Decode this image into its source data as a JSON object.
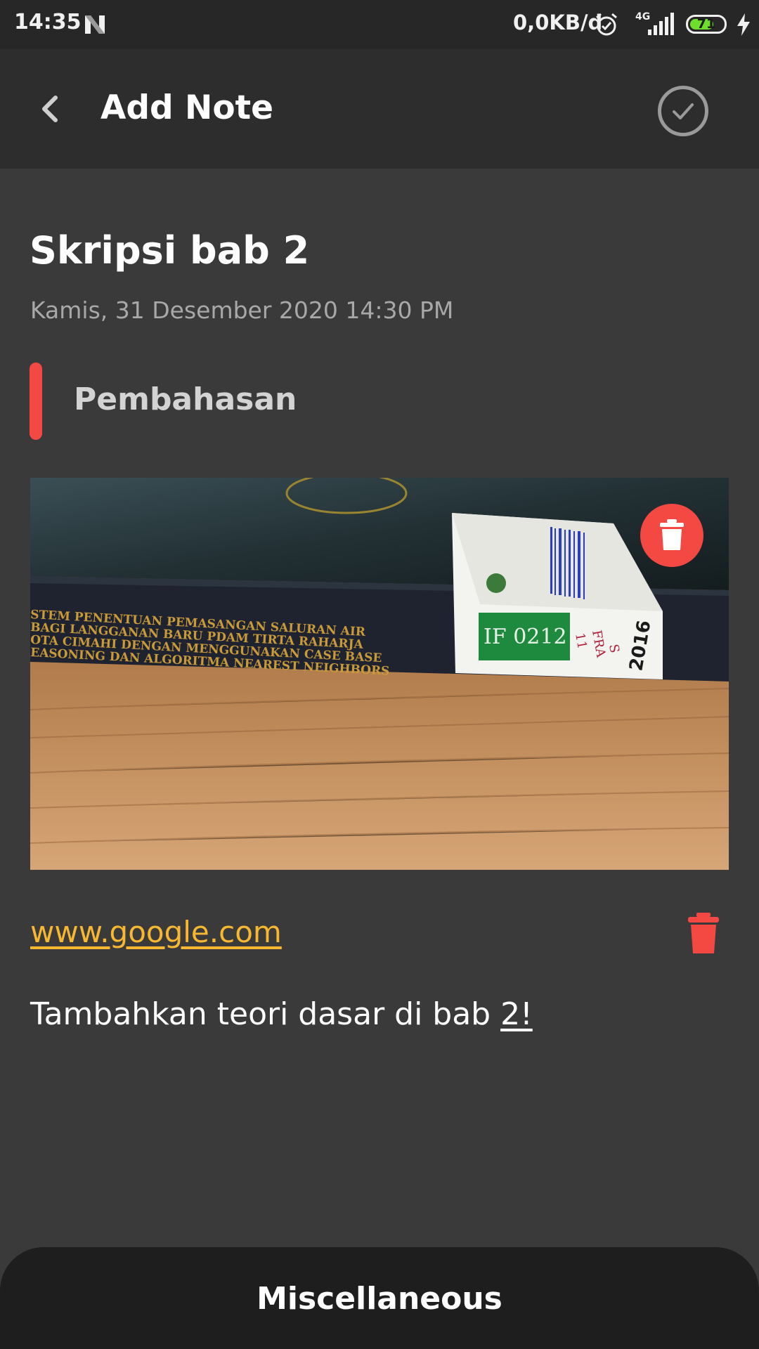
{
  "status_bar": {
    "time": "14:35",
    "notification_icon": "n-icon",
    "network_speed": "0,0KB/d",
    "network_type": "4G",
    "battery_level": "71",
    "battery_fraction": 0.71
  },
  "app_bar": {
    "title": "Add Note",
    "back_icon": "chevron-left-icon",
    "save_icon": "check-circle-icon"
  },
  "note": {
    "title": "Skripsi bab 2",
    "datetime": "Kamis, 31 Desember 2020 14:30 PM",
    "subtitle": "Pembahasan",
    "link": "www.google.com",
    "body_prefix": "Tambahkan teori dasar di bab ",
    "body_underlined": "2!"
  },
  "image": {
    "description": "Photo of a thesis book spine lying on a wooden table",
    "spine_line_1": "STEM PENENTUAN PEMASANGAN SALURAN AIR",
    "spine_line_2": "BAGI LANGGANAN BARU PDAM TIRTA RAHARJA",
    "spine_line_3": "OTA CIMAHI DENGAN MENGGUNAKAN CASE BASE",
    "spine_line_4": "EASONING DAN ALGORITMA NEAREST NEIGHBORS",
    "label_code": "IF 0212",
    "label_num": "11",
    "label_fra": "FRA",
    "label_s": "S",
    "label_year": "2016"
  },
  "bottom_sheet": {
    "label": "Miscellaneous"
  },
  "colors": {
    "accent_red": "#f44842",
    "link_yellow": "#f7b731",
    "background": "#3a3a3a",
    "app_bar": "#2d2d2d",
    "sheet": "#1e1e1e"
  }
}
